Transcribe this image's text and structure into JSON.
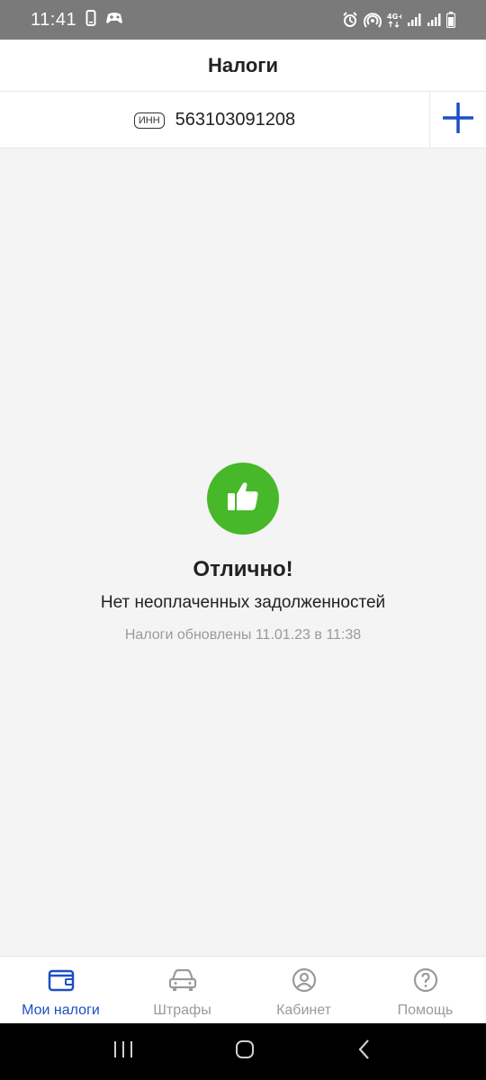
{
  "status_bar": {
    "time": "11:41",
    "network": "4G+"
  },
  "header": {
    "title": "Налоги"
  },
  "inn": {
    "badge": "ИНН",
    "number": "563103091208"
  },
  "empty_state": {
    "title": "Отлично!",
    "subtitle": "Нет неоплаченных задолженностей",
    "updated": "Налоги обновлены 11.01.23 в 11:38"
  },
  "bottom_nav": {
    "items": [
      {
        "label": "Мои налоги",
        "icon": "wallet-icon",
        "active": true
      },
      {
        "label": "Штрафы",
        "icon": "car-icon",
        "active": false
      },
      {
        "label": "Кабинет",
        "icon": "profile-icon",
        "active": false
      },
      {
        "label": "Помощь",
        "icon": "help-icon",
        "active": false
      }
    ]
  },
  "colors": {
    "accent": "#1a4fc4",
    "success": "#46b829",
    "muted": "#9a9a9a",
    "background": "#f4f4f4"
  }
}
